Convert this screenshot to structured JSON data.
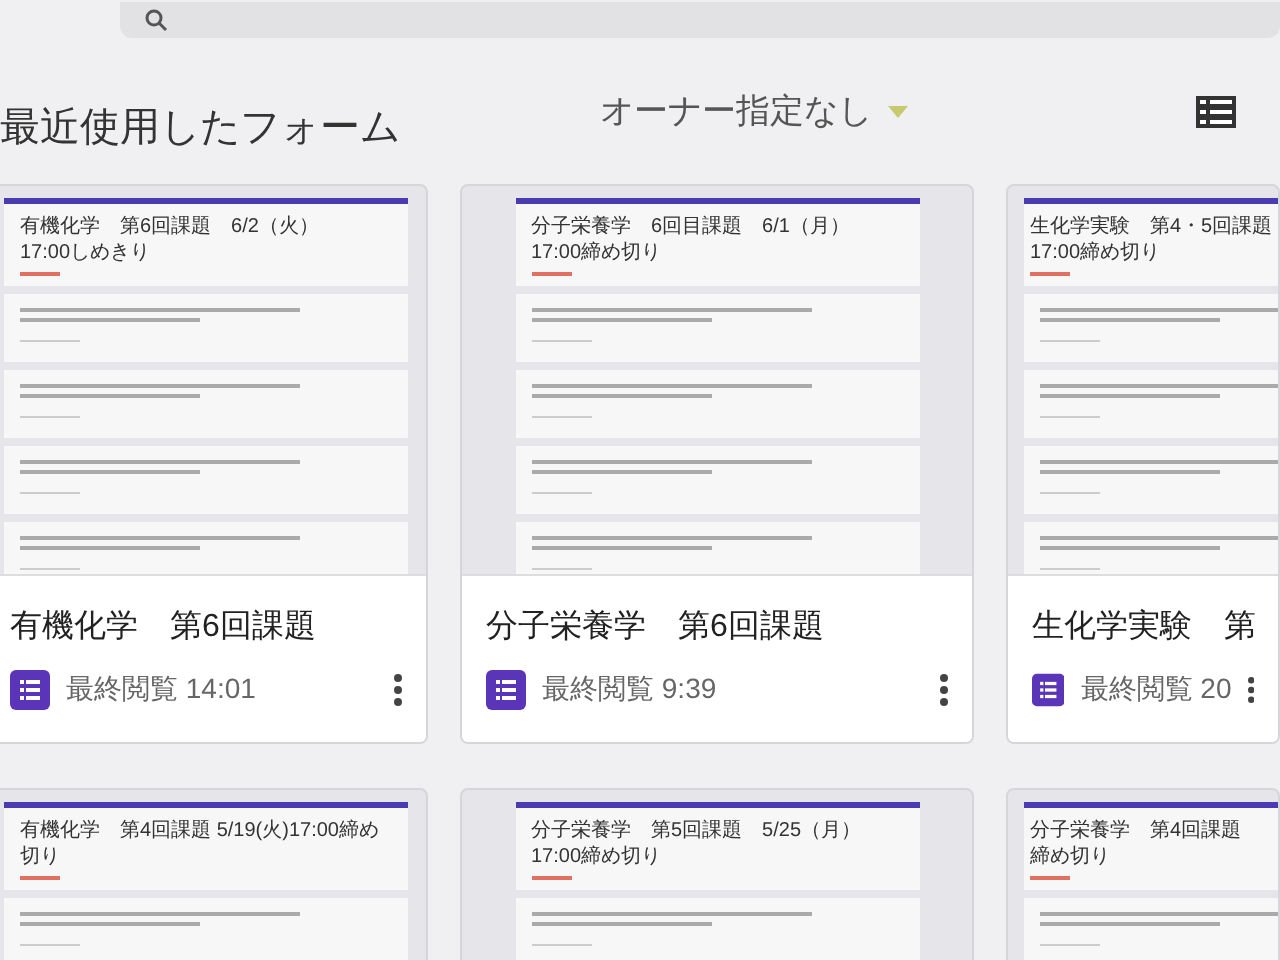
{
  "header": {
    "title": "最近使用したフォーム",
    "owner_filter": "オーナー指定なし"
  },
  "forms": [
    {
      "preview_title": [
        "有機化学　第6回課題　6/2（火）",
        "17:00しめきり"
      ],
      "name": "有機化学　第6回課題",
      "meta": "最終閲覧 14:01"
    },
    {
      "preview_title": [
        "分子栄養学　6回目課題　6/1（月）",
        "17:00締め切り"
      ],
      "name": "分子栄養学　第6回課題",
      "meta": "最終閲覧 9:39"
    },
    {
      "preview_title": [
        "生化学実験　第4・5回課題",
        "17:00締め切り"
      ],
      "name": "生化学実験　第",
      "meta": "最終閲覧 20"
    },
    {
      "preview_title": [
        "有機化学　第4回課題 5/19(火)17:00締め",
        "切り"
      ]
    },
    {
      "preview_title": [
        "分子栄養学　第5回課題　5/25（月）",
        "17:00締め切り"
      ]
    },
    {
      "preview_title": [
        "分子栄養学　第4回課題",
        "締め切り"
      ]
    }
  ]
}
